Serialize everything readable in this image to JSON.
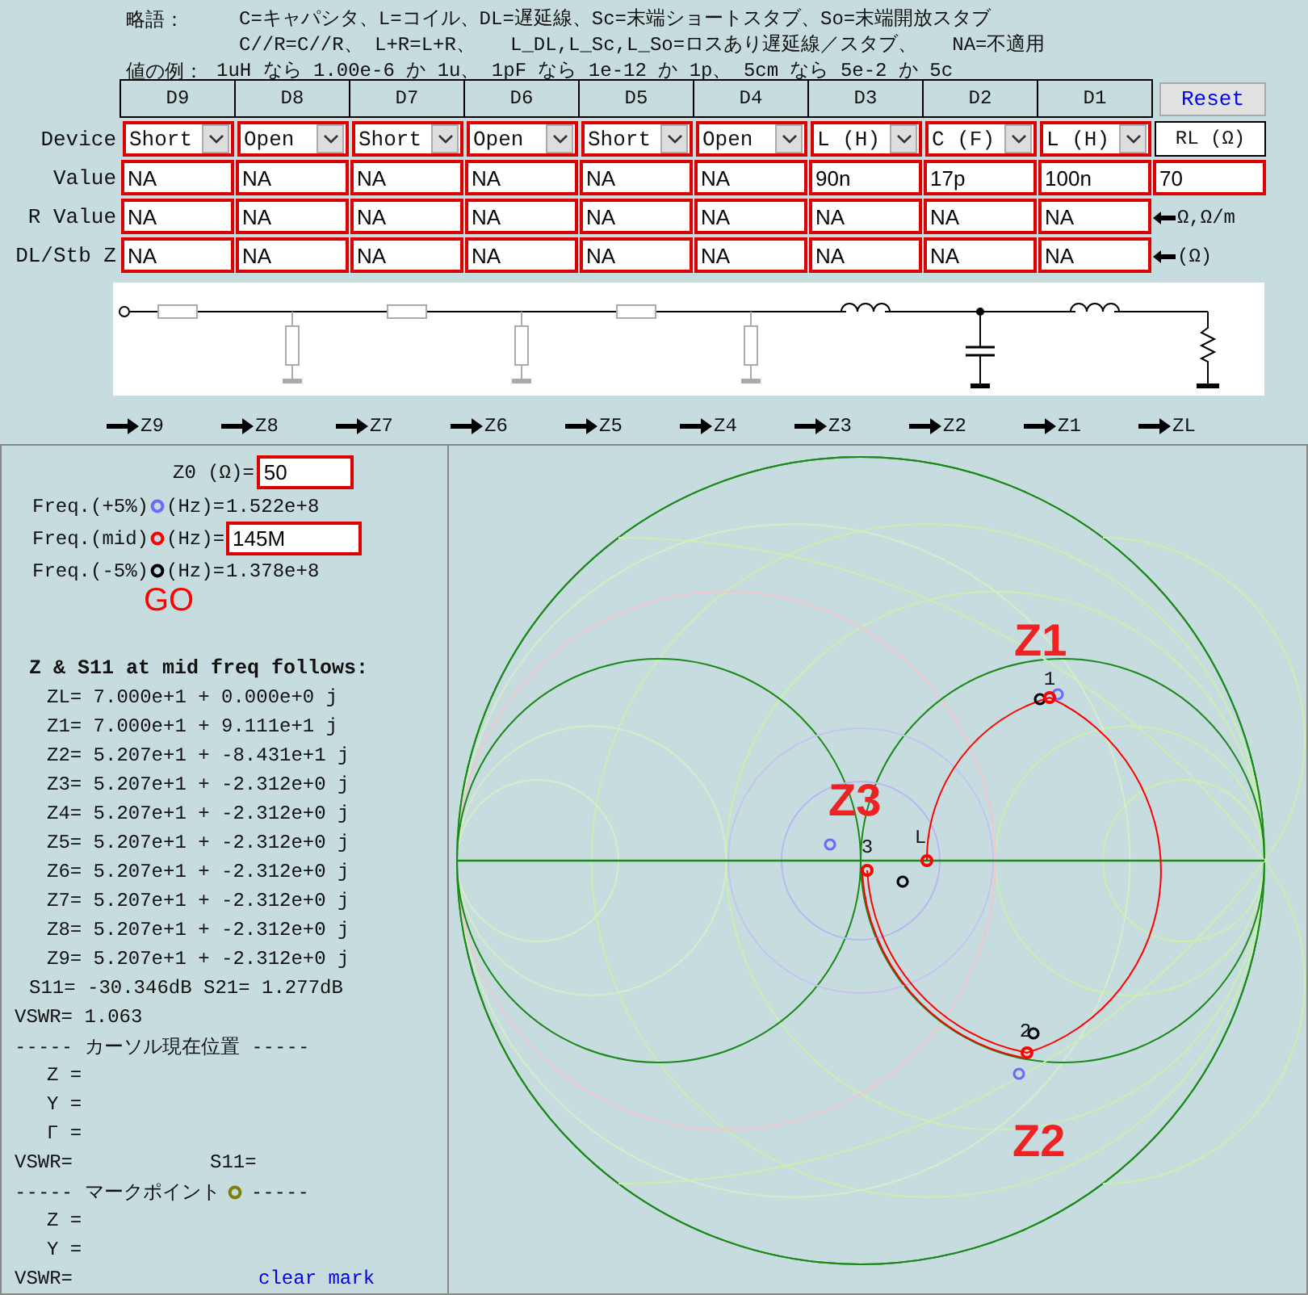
{
  "legend": {
    "title": "略語：",
    "lines": [
      "C=キャパシタ、L=コイル、DL=遅延線、Sc=末端ショートスタブ、So=末端開放スタブ",
      "C//R=C//R、 L+R=L+R、   L_DL,L_Sc,L_So=ロスあり遅延線／スタブ、   NA=不適用"
    ],
    "example_title": "値の例：",
    "example": "1uH なら 1.00e-6 か 1u、 1pF なら 1e-12 か 1p、 5cm なら 5e-2 か 5c"
  },
  "row_labels": [
    "Device",
    "Value",
    "R Value",
    "DL/Stb Z"
  ],
  "stages": [
    {
      "name": "D9",
      "device": "Short",
      "value": "NA",
      "r_value": "NA",
      "dl_z": "NA",
      "kind": "unused"
    },
    {
      "name": "D8",
      "device": "Open",
      "value": "NA",
      "r_value": "NA",
      "dl_z": "NA",
      "kind": "unused"
    },
    {
      "name": "D7",
      "device": "Short",
      "value": "NA",
      "r_value": "NA",
      "dl_z": "NA",
      "kind": "unused"
    },
    {
      "name": "D6",
      "device": "Open",
      "value": "NA",
      "r_value": "NA",
      "dl_z": "NA",
      "kind": "unused"
    },
    {
      "name": "D5",
      "device": "Short",
      "value": "NA",
      "r_value": "NA",
      "dl_z": "NA",
      "kind": "unused"
    },
    {
      "name": "D4",
      "device": "Open",
      "value": "NA",
      "r_value": "NA",
      "dl_z": "NA",
      "kind": "unused"
    },
    {
      "name": "D3",
      "device": "L (H)",
      "value": "90n",
      "r_value": "NA",
      "dl_z": "NA",
      "kind": "inductor"
    },
    {
      "name": "D2",
      "device": "C (F)",
      "value": "17p",
      "r_value": "NA",
      "dl_z": "NA",
      "kind": "capacitor"
    },
    {
      "name": "D1",
      "device": "L (H)",
      "value": "100n",
      "r_value": "NA",
      "dl_z": "NA",
      "kind": "inductor"
    }
  ],
  "reset_button": "Reset",
  "load": {
    "device": "RL (Ω)",
    "value": "70"
  },
  "unit_notes": [
    "Ω,Ω/m",
    "(Ω)"
  ],
  "nodes": [
    "Z9",
    "Z8",
    "Z7",
    "Z6",
    "Z5",
    "Z4",
    "Z3",
    "Z2",
    "Z1",
    "ZL"
  ],
  "z0": {
    "label": "Z0 (Ω)=",
    "value": "50"
  },
  "frequencies": [
    {
      "label": "Freq.(+5%)",
      "unit": "(Hz)=",
      "value": "1.522e+8",
      "color": "#6b6bff",
      "kind": "text"
    },
    {
      "label": "Freq.(mid)",
      "unit": "(Hz)=",
      "value": "145M",
      "color": "#ff0000",
      "kind": "input"
    },
    {
      "label": "Freq.(-5%)",
      "unit": "(Hz)=",
      "value": "1.378e+8",
      "color": "#000000",
      "kind": "text"
    }
  ],
  "go_button": "GO",
  "results": {
    "title": "Z & S11 at mid freq follows:",
    "lines": [
      "ZL= 7.000e+1 + 0.000e+0 j",
      "Z1= 7.000e+1 + 9.111e+1 j",
      "Z2= 5.207e+1 + -8.431e+1 j",
      "Z3= 5.207e+1 + -2.312e+0 j",
      "Z4= 5.207e+1 + -2.312e+0 j",
      "Z5= 5.207e+1 + -2.312e+0 j",
      "Z6= 5.207e+1 + -2.312e+0 j",
      "Z7= 5.207e+1 + -2.312e+0 j",
      "Z8= 5.207e+1 + -2.312e+0 j",
      "Z9= 5.207e+1 + -2.312e+0 j"
    ],
    "s_params": "S11= -30.346dB S21= 1.277dB",
    "vswr": "VSWR= 1.063"
  },
  "cursor": {
    "title": "----- カーソル現在位置 -----",
    "fields": [
      "Z =",
      "Y =",
      "Γ ="
    ],
    "vswr": "VSWR=",
    "s11": "S11="
  },
  "mark": {
    "title_left": "----- マークポイント",
    "title_right": "-----",
    "fields": [
      "Z =",
      "Y ="
    ],
    "vswr": "VSWR=",
    "clear_link": "clear mark"
  },
  "chart_labels": {
    "stages": [
      "Z1",
      "Z2",
      "Z3"
    ],
    "points": [
      "1",
      "2",
      "3",
      "L"
    ]
  }
}
